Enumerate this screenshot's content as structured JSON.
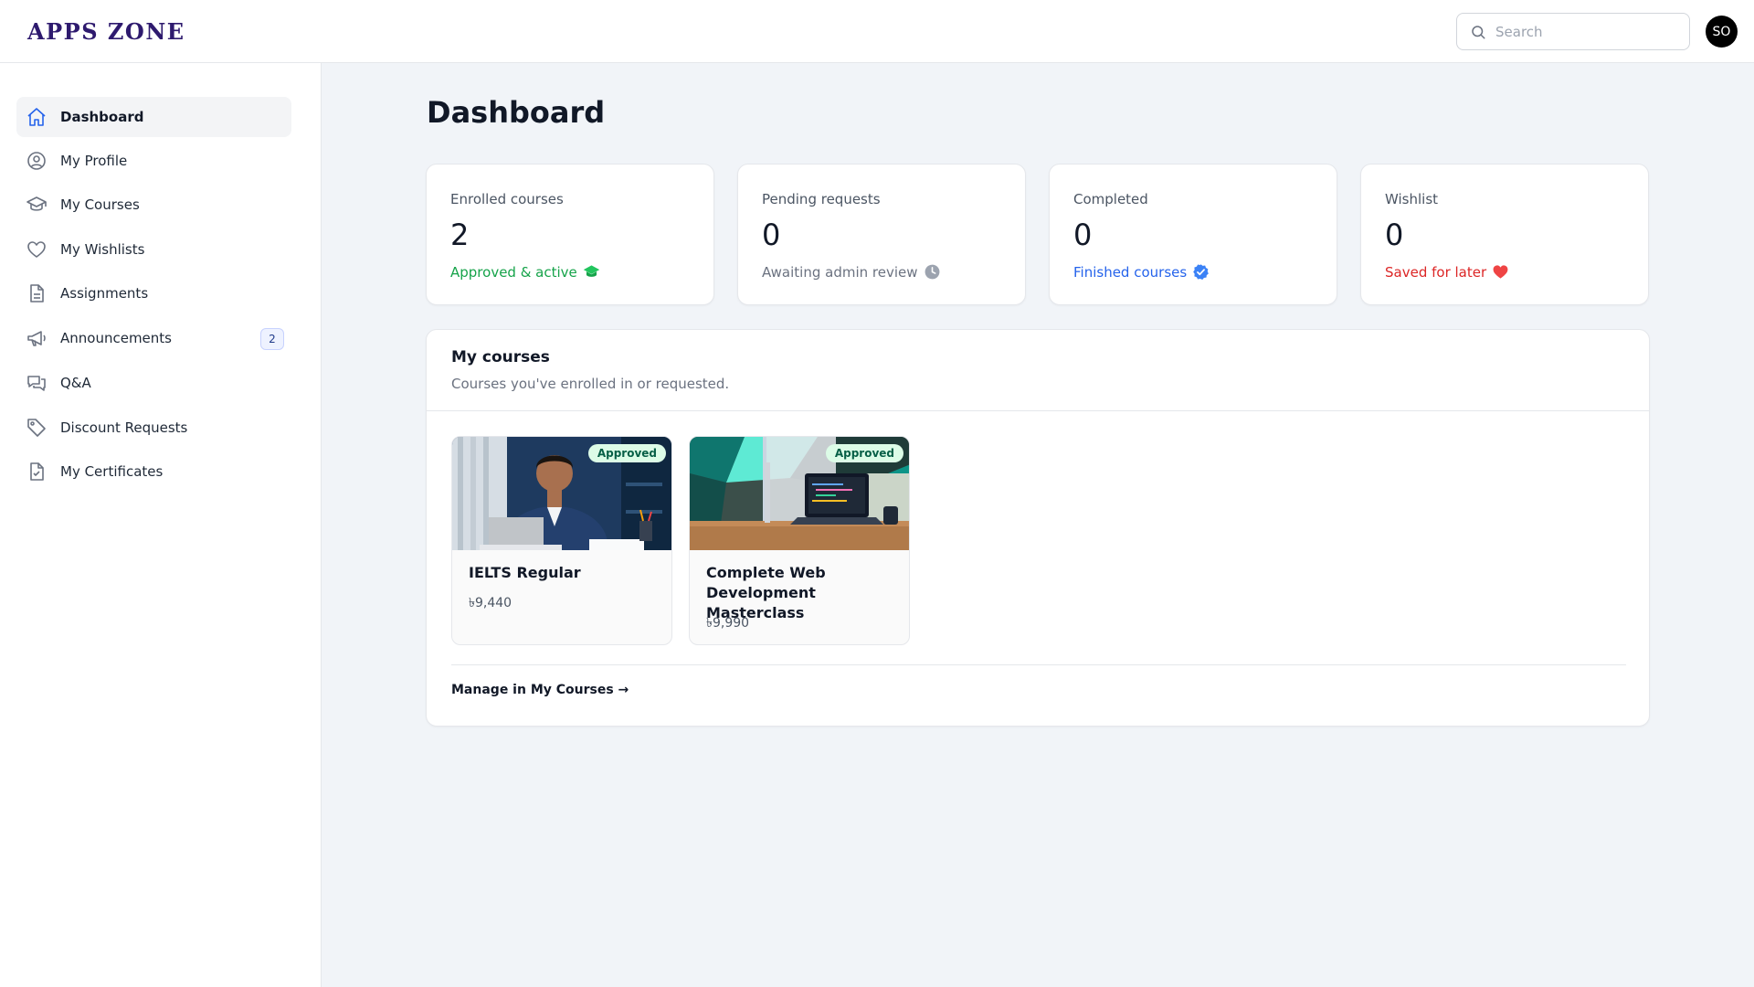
{
  "header": {
    "logo": "APPS ZONE",
    "search_placeholder": "Search",
    "avatar_initials": "SO"
  },
  "sidebar": {
    "items": [
      {
        "label": "Dashboard",
        "icon": "home-icon",
        "active": true
      },
      {
        "label": "My Profile",
        "icon": "user-circle-icon"
      },
      {
        "label": "My Courses",
        "icon": "graduation-cap-icon"
      },
      {
        "label": "My Wishlists",
        "icon": "heart-icon"
      },
      {
        "label": "Assignments",
        "icon": "document-icon"
      },
      {
        "label": "Announcements",
        "icon": "megaphone-icon",
        "badge": "2"
      },
      {
        "label": "Q&A",
        "icon": "chat-bubbles-icon"
      },
      {
        "label": "Discount Requests",
        "icon": "tag-icon"
      },
      {
        "label": "My Certificates",
        "icon": "certificate-icon"
      }
    ]
  },
  "main": {
    "title": "Dashboard",
    "stats": [
      {
        "label": "Enrolled courses",
        "value": "2",
        "sub": "Approved & active",
        "sub_color": "#16a34a",
        "icon": "graduation-cap-icon"
      },
      {
        "label": "Pending requests",
        "value": "0",
        "sub": "Awaiting admin review",
        "sub_color": "#6b7280",
        "icon": "clock-icon"
      },
      {
        "label": "Completed",
        "value": "0",
        "sub": "Finished courses",
        "sub_color": "#2563eb",
        "icon": "check-badge-icon"
      },
      {
        "label": "Wishlist",
        "value": "0",
        "sub": "Saved for later",
        "sub_color": "#dc2626",
        "icon": "heart-icon"
      }
    ],
    "courses_panel": {
      "title": "My courses",
      "subtitle": "Courses you've enrolled in or requested.",
      "courses": [
        {
          "name": "IELTS Regular",
          "price": "৳9,440",
          "badge": "Approved"
        },
        {
          "name": "Complete Web Development Masterclass",
          "price": "৳9,990",
          "badge": "Approved"
        }
      ],
      "manage_link": "Manage in My Courses →"
    }
  }
}
